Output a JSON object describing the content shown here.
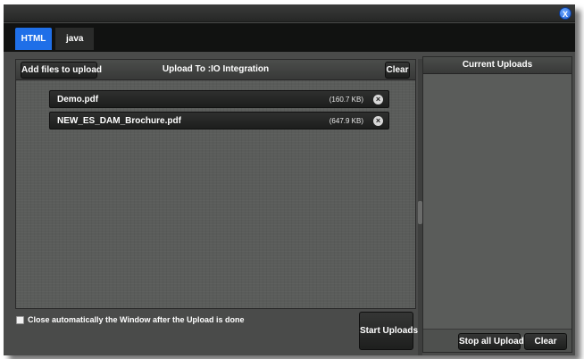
{
  "window": {
    "close_label": "X"
  },
  "tabs": [
    {
      "label": "HTML",
      "active": true
    },
    {
      "label": "java",
      "active": false
    }
  ],
  "upload_panel": {
    "add_files_label": "Add files to upload",
    "title": "Upload To :IO Integration",
    "clear_label": "Clear",
    "files": [
      {
        "name": "Demo.pdf",
        "size": "(160.7 KB)"
      },
      {
        "name": "NEW_ES_DAM_Brochure.pdf",
        "size": "(647.9 KB)"
      }
    ]
  },
  "options": {
    "auto_close_label": "Close automatically the Window after the Upload is done",
    "auto_close_checked": false
  },
  "start_uploads_label": "Start Uploads",
  "current_uploads_panel": {
    "title": "Current Uploads",
    "stop_all_label": "Stop all Uploads",
    "clear_label": "Clear"
  },
  "colors": {
    "active_tab": "#1f6fe8",
    "panel_background": "#5a5c5a",
    "tab_bar": "#111211"
  }
}
